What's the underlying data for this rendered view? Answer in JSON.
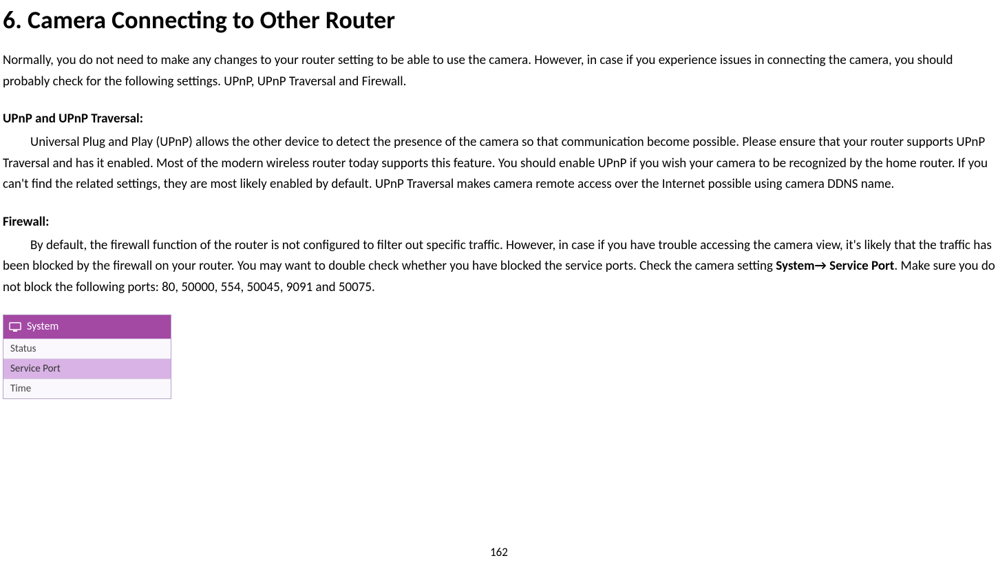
{
  "heading": "6. Camera Connecting to Other Router",
  "intro": "Normally, you do not need to make any changes to your router setting to be able to use the camera. However, in case if you experience issues in connecting the camera, you should probably check for the following settings. UPnP, UPnP Traversal and Firewall.",
  "section1": {
    "title": "UPnP and UPnP Traversal:",
    "body": "Universal Plug and Play (UPnP) allows the other device to detect the presence of the camera so that communication become possible. Please ensure that your router supports UPnP Traversal and has it enabled. Most of the modern wireless router today supports this feature. You should enable UPnP if you wish your camera to be recognized by the home router. If you can't find the related settings, they are most likely enabled by default. UPnP Traversal makes camera remote access over the Internet possible using camera DDNS name."
  },
  "section2": {
    "title": "Firewall:",
    "body_prefix": "By default, the firewall function of the router is not configured to filter out specific traffic. However, in case if you have trouble accessing the camera view, it's likely that the traffic has been blocked by the firewall on your router. You may want to double check whether you have blocked the service ports. Check the camera setting ",
    "nav_system": "System",
    "nav_arrow": "→",
    "nav_port": " Service Port",
    "body_suffix": ". Make sure you do not block the following ports: 80, 50000, 554, 50045, 9091 and 50075."
  },
  "menu": {
    "header": "System",
    "items": [
      "Status",
      "Service Port",
      "Time"
    ],
    "selected_index": 1
  },
  "page_number": "162"
}
